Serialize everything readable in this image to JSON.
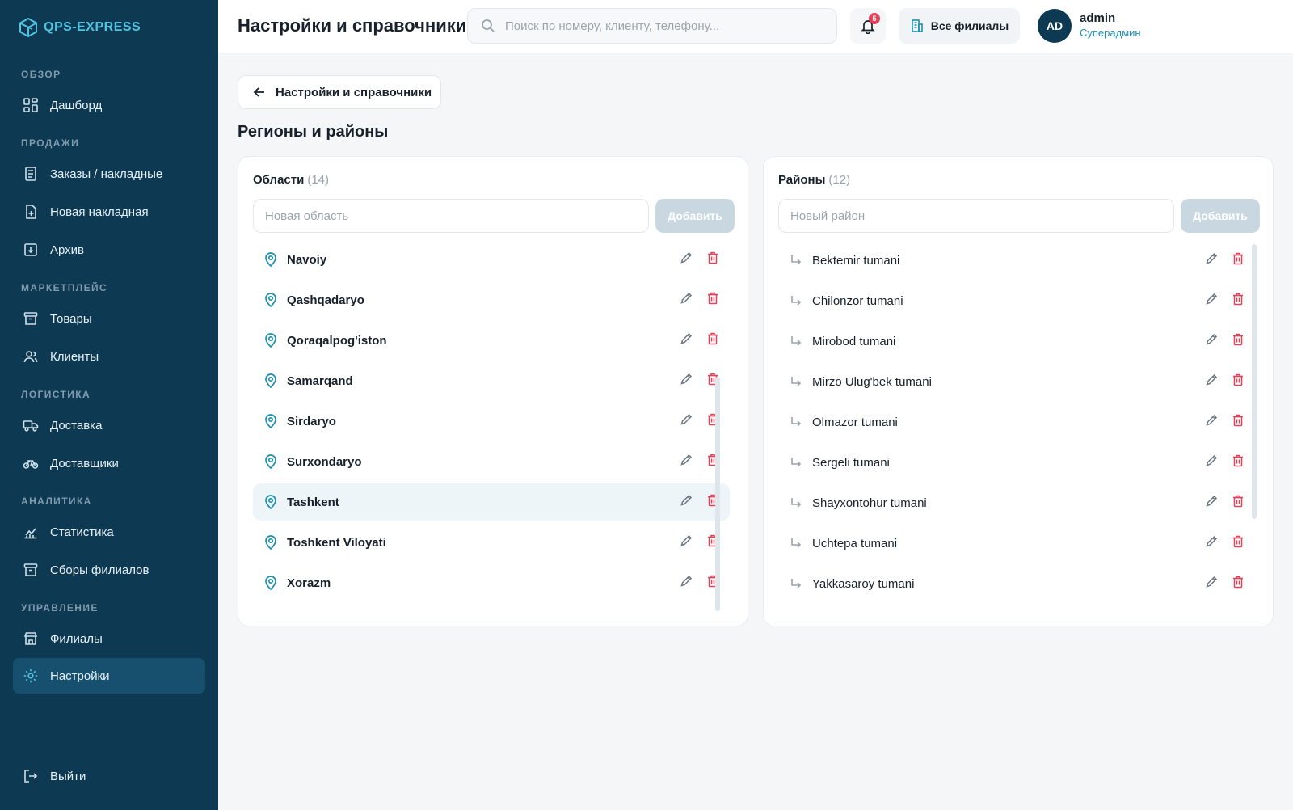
{
  "app": {
    "logo_text": "QPS-EXPRESS"
  },
  "colors": {
    "sidebar_bg": "#0d3a52",
    "accent": "#1e8fb0",
    "danger": "#e0445a",
    "active_item_bg": "#17506f"
  },
  "sidebar": {
    "sections": [
      {
        "title": "ОБЗОР"
      },
      {
        "title": "ПРОДАЖИ"
      },
      {
        "title": "МАРКЕТПЛЕЙС"
      },
      {
        "title": "ЛОГИСТИКА"
      },
      {
        "title": "АНАЛИТИКА"
      },
      {
        "title": "УПРАВЛЕНИЕ"
      }
    ],
    "items": [
      {
        "label": "Дашборд",
        "icon": "dashboard-icon"
      },
      {
        "label": "Заказы / накладные",
        "icon": "orders-icon"
      },
      {
        "label": "Новая накладная",
        "icon": "new-invoice-icon"
      },
      {
        "label": "Архив",
        "icon": "archive-icon"
      },
      {
        "label": "Товары",
        "icon": "box-icon"
      },
      {
        "label": "Клиенты",
        "icon": "users-icon"
      },
      {
        "label": "Доставка",
        "icon": "truck-icon"
      },
      {
        "label": "Доставщики",
        "icon": "bike-icon"
      },
      {
        "label": "Статистика",
        "icon": "chart-icon"
      },
      {
        "label": "Сборы филиалов",
        "icon": "collection-icon"
      },
      {
        "label": "Филиалы",
        "icon": "store-icon"
      },
      {
        "label": "Настройки",
        "icon": "gear-icon",
        "active": true
      }
    ],
    "logout_label": "Выйти"
  },
  "header": {
    "title": "Настройки и справочники",
    "search_placeholder": "Поиск по номеру, клиенту, телефону...",
    "notifications_count": "5",
    "branch_label": "Все филиалы",
    "user": {
      "initials": "AD",
      "name": "admin",
      "role": "Суперадмин"
    }
  },
  "main": {
    "back_label": "Настройки и справочники",
    "page_title": "Регионы и районы",
    "regions": {
      "title": "Области",
      "count": "(14)",
      "input_placeholder": "Новая область",
      "add_label": "Добавить",
      "selected": "Tashkent",
      "items": [
        "Navoiy",
        "Qashqadaryo",
        "Qoraqalpog'iston",
        "Samarqand",
        "Sirdaryo",
        "Surxondaryo",
        "Tashkent",
        "Toshkent Viloyati",
        "Xorazm"
      ]
    },
    "districts": {
      "title": "Районы",
      "count": "(12)",
      "input_placeholder": "Новый район",
      "add_label": "Добавить",
      "items": [
        "Bektemir tumani",
        "Chilonzor tumani",
        "Mirobod tumani",
        "Mirzo Ulug'bek tumani",
        "Olmazor tumani",
        "Sergeli tumani",
        "Shayxontohur tumani",
        "Uchtepa tumani",
        "Yakkasaroy tumani"
      ]
    }
  }
}
